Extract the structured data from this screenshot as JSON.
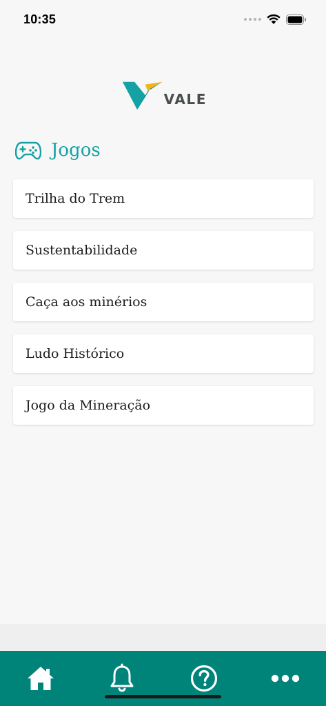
{
  "status_bar": {
    "time": "10:35"
  },
  "logo": {
    "text": "VALE",
    "colors": {
      "teal": "#16a1a4",
      "gold": "#f2b31b",
      "dark_teal": "#007e7a",
      "text": "#4a4d4e"
    }
  },
  "section": {
    "icon": "gamepad-icon",
    "title": "Jogos"
  },
  "games": [
    {
      "label": "Trilha do Trem"
    },
    {
      "label": "Sustentabilidade"
    },
    {
      "label": "Caça aos minérios"
    },
    {
      "label": "Ludo Histórico"
    },
    {
      "label": "Jogo da Mineração"
    }
  ],
  "tab_bar": {
    "background": "#00847a",
    "items": [
      {
        "icon": "home-icon"
      },
      {
        "icon": "bell-icon"
      },
      {
        "icon": "help-icon"
      },
      {
        "icon": "more-icon"
      }
    ]
  },
  "theme": {
    "accent": "#16a1a4",
    "background": "#f7f7f7"
  }
}
